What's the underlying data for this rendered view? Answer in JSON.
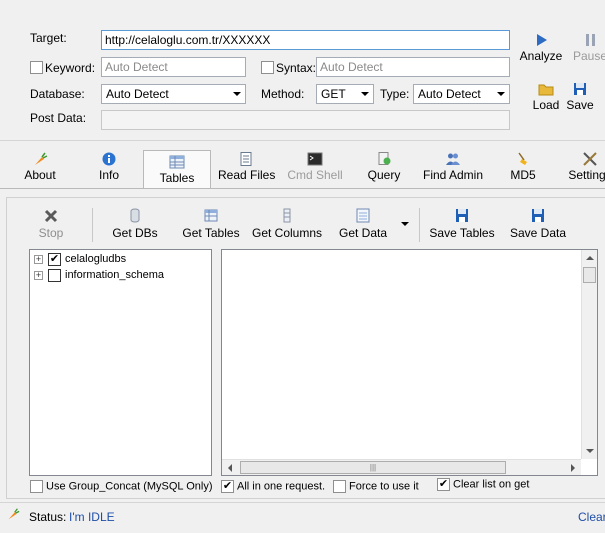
{
  "target": {
    "label": "Target:",
    "value": "http://celaloglu.com.tr/XXXXXX"
  },
  "keyword": {
    "label": "Keyword:",
    "placeholder": "Auto Detect",
    "checked": false
  },
  "syntax": {
    "label": "Syntax:",
    "placeholder": "Auto Detect",
    "checked": false
  },
  "database": {
    "label": "Database:",
    "selected": "Auto Detect"
  },
  "method": {
    "label": "Method:",
    "selected": "GET"
  },
  "type": {
    "label": "Type:",
    "selected": "Auto Detect"
  },
  "post_data": {
    "label": "Post Data:",
    "value": ""
  },
  "side_buttons": {
    "analyze": "Analyze",
    "pause": "Pause",
    "load": "Load",
    "save": "Save"
  },
  "tabs": [
    {
      "label": "About"
    },
    {
      "label": "Info"
    },
    {
      "label": "Tables"
    },
    {
      "label": "Read Files"
    },
    {
      "label": "Cmd Shell"
    },
    {
      "label": "Query"
    },
    {
      "label": "Find Admin"
    },
    {
      "label": "MD5"
    },
    {
      "label": "Settings"
    }
  ],
  "toolbar": {
    "stop": "Stop",
    "get_dbs": "Get DBs",
    "get_tables": "Get Tables",
    "get_columns": "Get Columns",
    "get_data": "Get Data",
    "save_tables": "Save Tables",
    "save_data": "Save Data"
  },
  "tree": [
    {
      "label": "celalogludbs",
      "checked": true
    },
    {
      "label": "information_schema",
      "checked": false
    }
  ],
  "options": {
    "group_concat": {
      "label": "Use Group_Concat (MySQL Only)",
      "checked": false
    },
    "all_in_one": {
      "label": "All in one request.",
      "checked": true
    },
    "force_use": {
      "label": "Force to use it",
      "checked": false
    },
    "clear_list": {
      "label": "Clear list on get",
      "checked": true
    }
  },
  "status": {
    "label": "Status:",
    "value": "I'm IDLE",
    "clear": "Clear"
  },
  "colors": {
    "accent": "#1f4ea8",
    "background": "#f0f0f0"
  }
}
